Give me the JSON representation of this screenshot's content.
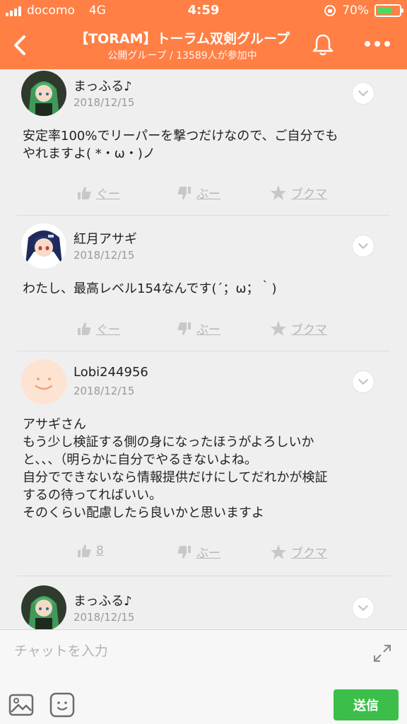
{
  "status_bar": {
    "carrier": "docomo",
    "network": "4G",
    "time": "4:59",
    "battery": "70%",
    "battery_level": 0.7
  },
  "header": {
    "title": "【TORAM】トーラム双剣グループ",
    "subtitle": "公開グループ / 13589人が参加中"
  },
  "posts": [
    {
      "name": "まっふる♪",
      "date": "2018/12/15",
      "avatar": "green-hair-character-avatar",
      "body": [
        "安定率100%でリーパーを撃つだけなので、ご自分でも",
        "やれますよ( *・ω・)ノ"
      ],
      "like_label": "ぐー",
      "dislike_label": "ぶー",
      "bookmark_label": "ブクマ"
    },
    {
      "name": "紅月アサギ",
      "date": "2018/12/15",
      "avatar": "blue-hair-character-avatar",
      "body": [
        "わたし、最高レベル154なんです(´；ω；｀)"
      ],
      "like_label": "ぐー",
      "dislike_label": "ぶー",
      "bookmark_label": "ブクマ"
    },
    {
      "name": "Lobi244956",
      "date": "2018/12/15",
      "avatar": "smiley-face-avatar",
      "body": [
        "アサギさん",
        "もう少し検証する側の身になったほうがよろしいか",
        "と、、、（明らかに自分でやるきないよね。",
        "自分でできないなら情報提供だけにしてだれかが検証",
        "するの待ってればいい。",
        "そのくらい配慮したら良いかと思いますよ"
      ],
      "like_label": "8",
      "dislike_label": "ぶー",
      "bookmark_label": "ブクマ"
    },
    {
      "name": "まっふる♪",
      "date": "2018/12/15",
      "avatar": "green-hair-character-avatar"
    }
  ],
  "input": {
    "placeholder": "チャットを入力",
    "send_label": "送信"
  },
  "colors": {
    "brand": "#ff7f45",
    "send": "#3bbf4a",
    "action": "#b5b5b5"
  }
}
